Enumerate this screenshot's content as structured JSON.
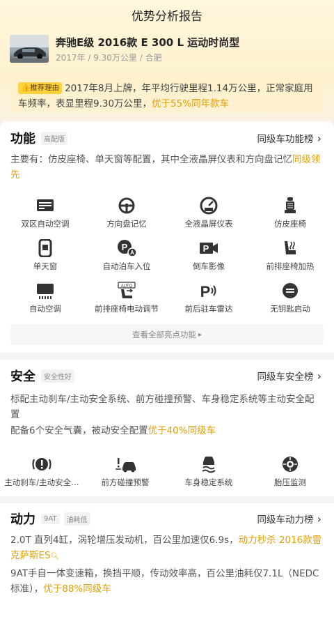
{
  "header": {
    "title": "优势分析报告"
  },
  "car": {
    "name": "奔驰E级 2016款 E 300 L 运动时尚型",
    "meta": "2017年 / 9.30万公里 / 合肥"
  },
  "recommend": {
    "badge": "推荐理由",
    "text": "2017年8月上牌，年平均行驶里程1.14万公里，正常家庭用车频率，表显里程9.30万公里，",
    "highlight": "优于55%同年款车"
  },
  "features": {
    "title": "功能",
    "tag": "高配版",
    "link": "同级车功能榜",
    "desc": "主要有：仿皮座椅、单天窗等配置，其中全液晶屏仪表和方向盘记忆",
    "desc_highlight": "同级领先",
    "items": [
      {
        "label": "双区自动空调",
        "icon": "dual-zone-ac-icon"
      },
      {
        "label": "方向盘记忆",
        "icon": "steering-wheel-icon"
      },
      {
        "label": "全液晶屏仪表",
        "icon": "lcd-gauge-icon"
      },
      {
        "label": "仿皮座椅",
        "icon": "leather-seat-icon"
      },
      {
        "label": "单天窗",
        "icon": "sunroof-icon"
      },
      {
        "label": "自动泊车入位",
        "icon": "auto-parking-icon"
      },
      {
        "label": "倒车影像",
        "icon": "reverse-camera-icon"
      },
      {
        "label": "前排座椅加热",
        "icon": "seat-heating-icon"
      },
      {
        "label": "自动空调",
        "icon": "auto-ac-icon"
      },
      {
        "label": "前排座椅电动调节",
        "icon": "power-seat-icon"
      },
      {
        "label": "前后驻车雷达",
        "icon": "parking-radar-icon"
      },
      {
        "label": "无钥匙启动",
        "icon": "keyless-start-icon"
      }
    ],
    "more": "查看全部亮点功能"
  },
  "safety": {
    "title": "安全",
    "tag": "安全性好",
    "link": "同级车安全榜",
    "desc1": "标配主动刹车/主动安全系统、前方碰撞预警、车身稳定系统等主动安全配置",
    "desc2": "配备6个安全气囊，被动安全配置",
    "desc2_highlight": "优于40%同级车",
    "items": [
      {
        "label": "主动刹车/主动安全…",
        "icon": "active-brake-icon"
      },
      {
        "label": "前方碰撞预警",
        "icon": "collision-warning-icon"
      },
      {
        "label": "车身稳定系统",
        "icon": "stability-control-icon"
      },
      {
        "label": "胎压监测",
        "icon": "tire-pressure-icon"
      }
    ]
  },
  "power": {
    "title": "动力",
    "tags": [
      "9AT",
      "油耗低"
    ],
    "link": "同级车动力榜",
    "desc1": "2.0T 直列4缸，涡轮增压发动机，百公里加速仅6.9s，",
    "desc1_highlight": "动力秒杀 2016款雷克萨斯ES",
    "desc2": "9AT手自一体变速箱，换挡平顺，传动效率高，百公里油耗仅7.1L（NEDC标准），",
    "desc2_highlight": "优于88%同级车"
  },
  "colors": {
    "accent": "#e0a000",
    "badge": "#ffd33f"
  }
}
